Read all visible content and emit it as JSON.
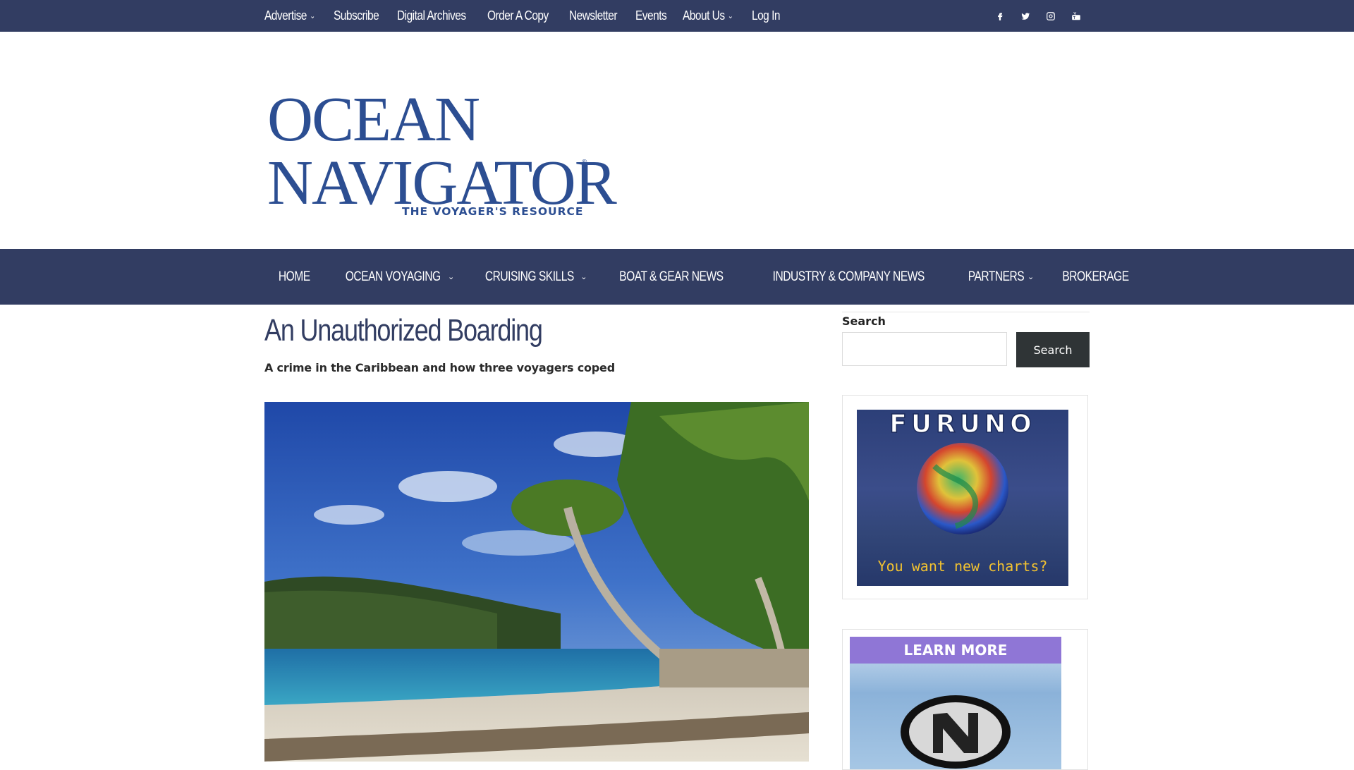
{
  "topbar": {
    "links": [
      {
        "label": "Advertise",
        "dropdown": true
      },
      {
        "label": "Subscribe",
        "dropdown": false
      },
      {
        "label": "Digital Archives",
        "dropdown": false
      },
      {
        "label": "Order A Copy",
        "dropdown": false
      },
      {
        "label": "Newsletter",
        "dropdown": false
      },
      {
        "label": "Events",
        "dropdown": false
      },
      {
        "label": "About Us",
        "dropdown": true
      },
      {
        "label": "Log In",
        "dropdown": false
      }
    ],
    "social_icons": [
      "facebook-icon",
      "twitter-icon",
      "instagram-icon",
      "youtube-icon"
    ]
  },
  "logo": {
    "line1": "OCEAN",
    "line2": "NAVIGATOR",
    "tagline": "THE VOYAGER'S RESOURCE"
  },
  "nav": {
    "items": [
      {
        "label": "HOME",
        "dropdown": false
      },
      {
        "label": "OCEAN VOYAGING",
        "dropdown": true
      },
      {
        "label": "CRUISING SKILLS",
        "dropdown": true
      },
      {
        "label": "BOAT & GEAR NEWS",
        "dropdown": false
      },
      {
        "label": "INDUSTRY & COMPANY NEWS",
        "dropdown": false
      },
      {
        "label": "PARTNERS",
        "dropdown": true
      },
      {
        "label": "BROKERAGE",
        "dropdown": false
      }
    ]
  },
  "article": {
    "title": "An Unauthorized Boarding",
    "subtitle": "A crime in the Caribbean and how three voyagers coped"
  },
  "sidebar": {
    "search_label": "Search",
    "search_placeholder": "",
    "search_button": "Search",
    "ad1": {
      "brand": "FURUNO",
      "tagline": "You want new charts?"
    },
    "ad2": {
      "cta": "LEARN MORE"
    }
  },
  "colors": {
    "navy": "#323d62",
    "logo_blue": "#2c4e92",
    "search_button": "#2f3436"
  }
}
